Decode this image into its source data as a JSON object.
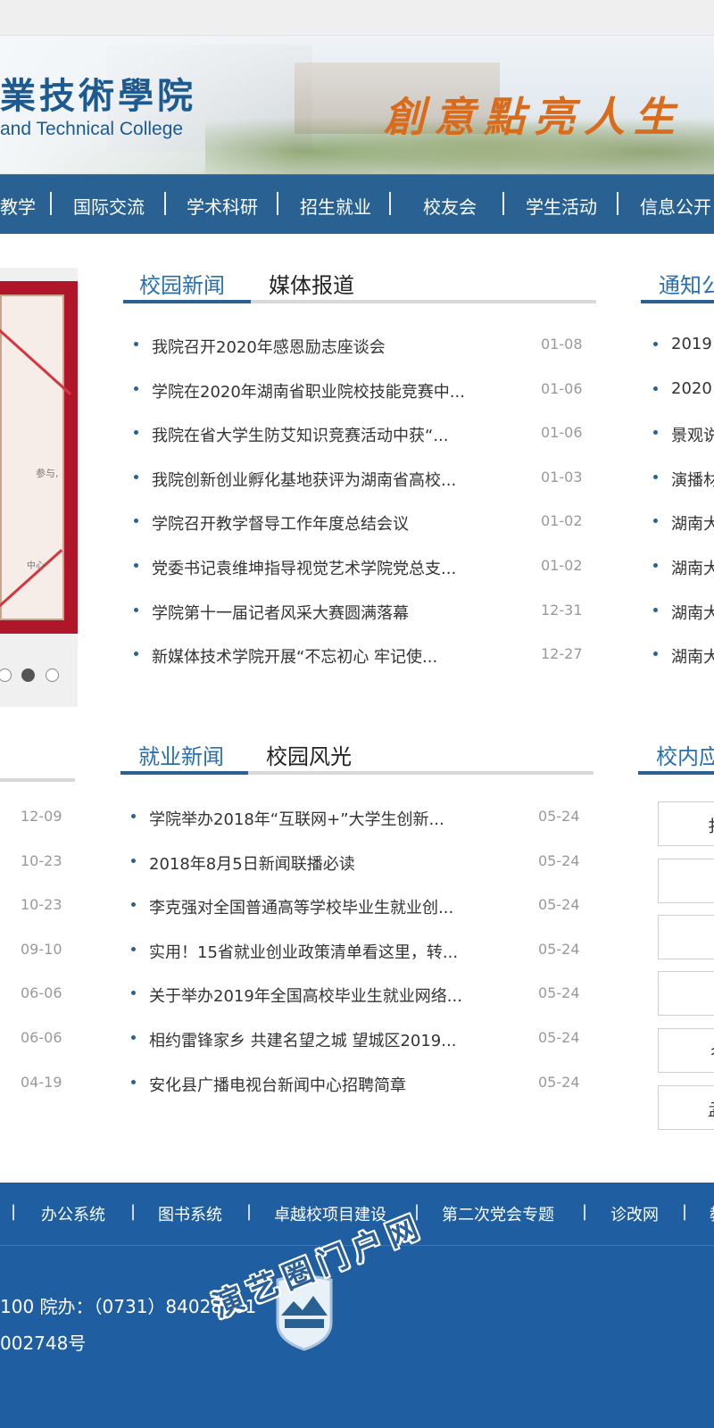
{
  "header": {
    "college_cn": "業技術學院",
    "college_en": "and Technical College",
    "slogan": "創意點亮人生"
  },
  "nav": {
    "items": [
      {
        "label": "教学"
      },
      {
        "label": "国际交流"
      },
      {
        "label": "学术科研"
      },
      {
        "label": "招生就业"
      },
      {
        "label": "校友会"
      },
      {
        "label": "学生活动"
      },
      {
        "label": "信息公开"
      }
    ]
  },
  "slideshow": {
    "text1": "参与,",
    "text2": "中心",
    "active_slide": 2
  },
  "campus_news": {
    "tabs": [
      "校园新闻",
      "媒体报道"
    ],
    "items": [
      {
        "title": "我院召开2020年感恩励志座谈会",
        "date": "01-08"
      },
      {
        "title": "学院在2020年湖南省职业院校技能竞赛中...",
        "date": "01-06"
      },
      {
        "title": "我院在省大学生防艾知识竞赛活动中获“...",
        "date": "01-06"
      },
      {
        "title": "我院创新创业孵化基地获评为湖南省高校...",
        "date": "01-03"
      },
      {
        "title": "学院召开教学督导工作年度总结会议",
        "date": "01-02"
      },
      {
        "title": "党委书记袁维坤指导视觉艺术学院党总支...",
        "date": "01-02"
      },
      {
        "title": "学院第十一届记者风采大赛圆满落幕",
        "date": "12-31"
      },
      {
        "title": "新媒体技术学院开展“不忘初心 牢记使...",
        "date": "12-27"
      }
    ]
  },
  "notices": {
    "tab": "通知公",
    "items": [
      {
        "title": "2019"
      },
      {
        "title": "2020"
      },
      {
        "title": "景观说"
      },
      {
        "title": "演播材"
      },
      {
        "title": "湖南大"
      },
      {
        "title": "湖南大"
      },
      {
        "title": "湖南大"
      },
      {
        "title": "湖南大"
      }
    ]
  },
  "left_dates": [
    "12-09",
    "10-23",
    "10-23",
    "09-10",
    "06-06",
    "06-06",
    "04-19"
  ],
  "job_news": {
    "tabs": [
      "就业新闻",
      "校园风光"
    ],
    "items": [
      {
        "title": "学院举办2018年“互联网+”大学生创新...",
        "date": "05-24"
      },
      {
        "title": "2018年8月5日新闻联播必读",
        "date": "05-24"
      },
      {
        "title": "李克强对全国普通高等学校毕业生就业创...",
        "date": "05-24"
      },
      {
        "title": "实用！15省就业创业政策清单看这里，转...",
        "date": "05-24"
      },
      {
        "title": "关于举办2019年全国高校毕业生就业网络...",
        "date": "05-24"
      },
      {
        "title": "相约雷锋家乡 共建名望之城 望城区2019...",
        "date": "05-24"
      },
      {
        "title": "安化县广播电视台新闻中心招聘简章",
        "date": "05-24"
      }
    ]
  },
  "apps": {
    "tab": "校内应",
    "buttons": [
      "扌",
      "",
      "",
      "",
      "彳",
      "孟"
    ]
  },
  "footer_links": [
    "办公系统",
    "图书系统",
    "卓越校项目建设",
    "第二次党会专题",
    "诊改网",
    "教"
  ],
  "footer": {
    "line1": "100 院办：（0731）84028501",
    "line2": "002748号"
  },
  "watermark": "演艺圈门户网",
  "colors": {
    "nav": "#2a6193",
    "accent": "#2a6fb0",
    "footer": "#1f5ea0",
    "slogan": "#d86c1c"
  }
}
